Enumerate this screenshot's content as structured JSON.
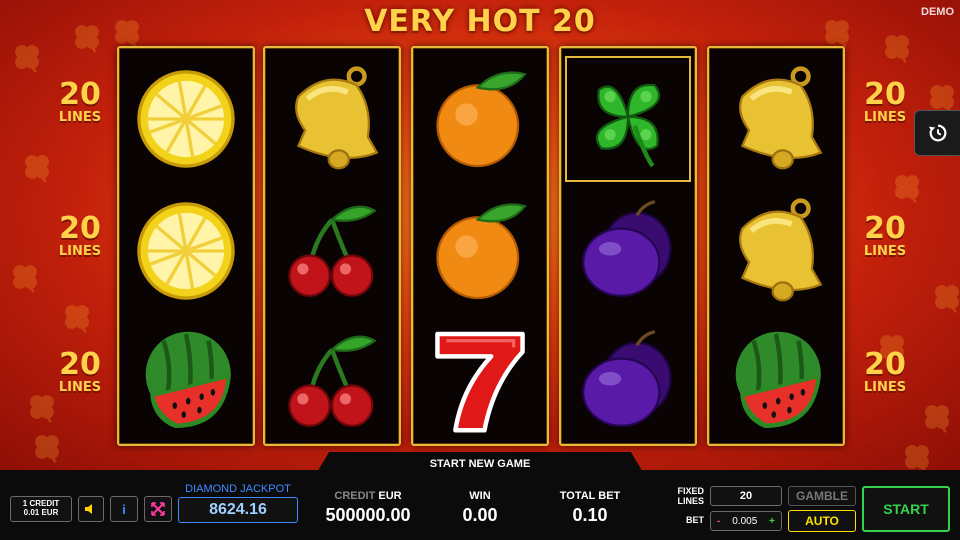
{
  "game": {
    "title": "VERY HOT 20",
    "mode_badge": "DEMO"
  },
  "lines_indicators": {
    "left": [
      {
        "number": "20",
        "label": "LINES"
      },
      {
        "number": "20",
        "label": "LINES"
      },
      {
        "number": "20",
        "label": "LINES"
      }
    ],
    "right": [
      {
        "number": "20",
        "label": "LINES"
      },
      {
        "number": "20",
        "label": "LINES"
      },
      {
        "number": "20",
        "label": "LINES"
      }
    ]
  },
  "reels": [
    [
      "lemon",
      "lemon",
      "watermelon"
    ],
    [
      "bell",
      "cherries",
      "cherries"
    ],
    [
      "orange",
      "orange",
      "seven"
    ],
    [
      "clover",
      "plum",
      "plum"
    ],
    [
      "bell",
      "bell",
      "watermelon"
    ]
  ],
  "highlighted_cell": {
    "reel": 4,
    "row": 1
  },
  "message": "START NEW GAME",
  "controls": {
    "credit_value_line1": "1 CREDIT",
    "credit_value_line2": "0.01 EUR",
    "sound_icon": "speaker-icon",
    "info_label": "i",
    "settings_icon": "fullscreen-icon",
    "history_icon": "history-icon"
  },
  "jackpot": {
    "label": "DIAMOND JACKPOT",
    "value": "8624.16"
  },
  "meters": {
    "credit_label_dim": "CREDIT",
    "credit_label_unit": "EUR",
    "credit_value": "500000.00",
    "win_label": "WIN",
    "win_value": "0.00",
    "total_bet_label": "TOTAL BET",
    "total_bet_value": "0.10"
  },
  "bet_panel": {
    "fixed_lines_label_1": "FIXED",
    "fixed_lines_label_2": "LINES",
    "lines_value": "20",
    "bet_label": "BET",
    "bet_minus": "-",
    "bet_value": "0.005",
    "bet_plus": "+"
  },
  "buttons": {
    "gamble": "GAMBLE",
    "auto": "AUTO",
    "start": "START"
  },
  "colors": {
    "frame_gold": "#e7b93a",
    "jackpot_blue": "#3f8bff",
    "start_green": "#34d34a",
    "auto_yellow": "#ffe000"
  }
}
